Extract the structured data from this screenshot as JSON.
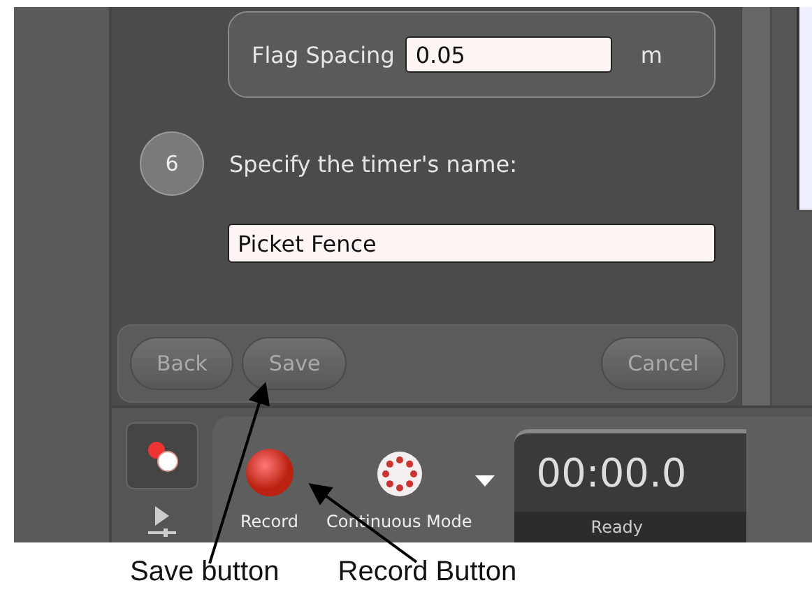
{
  "dialog": {
    "flag_spacing": {
      "label": "Flag Spacing",
      "value": "0.05",
      "unit": "m"
    },
    "step": {
      "number": "6",
      "prompt": "Specify the timer's name:"
    },
    "timer_name": {
      "value": "Picket Fence"
    },
    "buttons": [
      {
        "label": "Back",
        "kind": "left"
      },
      {
        "label": "Save",
        "kind": "left"
      },
      {
        "label": "Cancel",
        "kind": "right"
      }
    ]
  },
  "toolbar": {
    "record": {
      "label": "Record"
    },
    "mode": {
      "label": "Continuous Mode"
    },
    "timer": {
      "time": "00:00.0",
      "status": "Ready"
    }
  },
  "annotations": [
    {
      "label": "Save button"
    },
    {
      "label": "Record Button"
    }
  ]
}
